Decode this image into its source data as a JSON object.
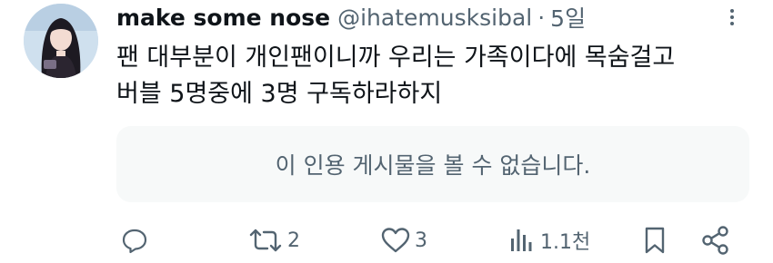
{
  "author": {
    "display_name": "make some nose",
    "handle": "@ihatemusksibal",
    "separator": "·",
    "time": "5일"
  },
  "tweet": {
    "lines": [
      "팬 대부분이 개인팬이니까 우리는 가족이다에 목숨걸고",
      "버블 5명중에 3명 구독하라하지"
    ]
  },
  "quote": {
    "unavailable_text": "이 인용 게시물을 볼 수 없습니다."
  },
  "actions": {
    "reply": {
      "icon": "reply-icon",
      "count": ""
    },
    "retweet": {
      "icon": "retweet-icon",
      "count": "2"
    },
    "like": {
      "icon": "heart-icon",
      "count": "3"
    },
    "views": {
      "icon": "views-chart-icon",
      "count": "1.1천"
    },
    "bookmark": {
      "icon": "bookmark-icon"
    },
    "share": {
      "icon": "share-icon"
    },
    "more": {
      "icon": "more-dots-icon"
    }
  },
  "colors": {
    "text": "#0f1419",
    "secondary": "#536471",
    "card_bg": "#f7f9f9"
  }
}
